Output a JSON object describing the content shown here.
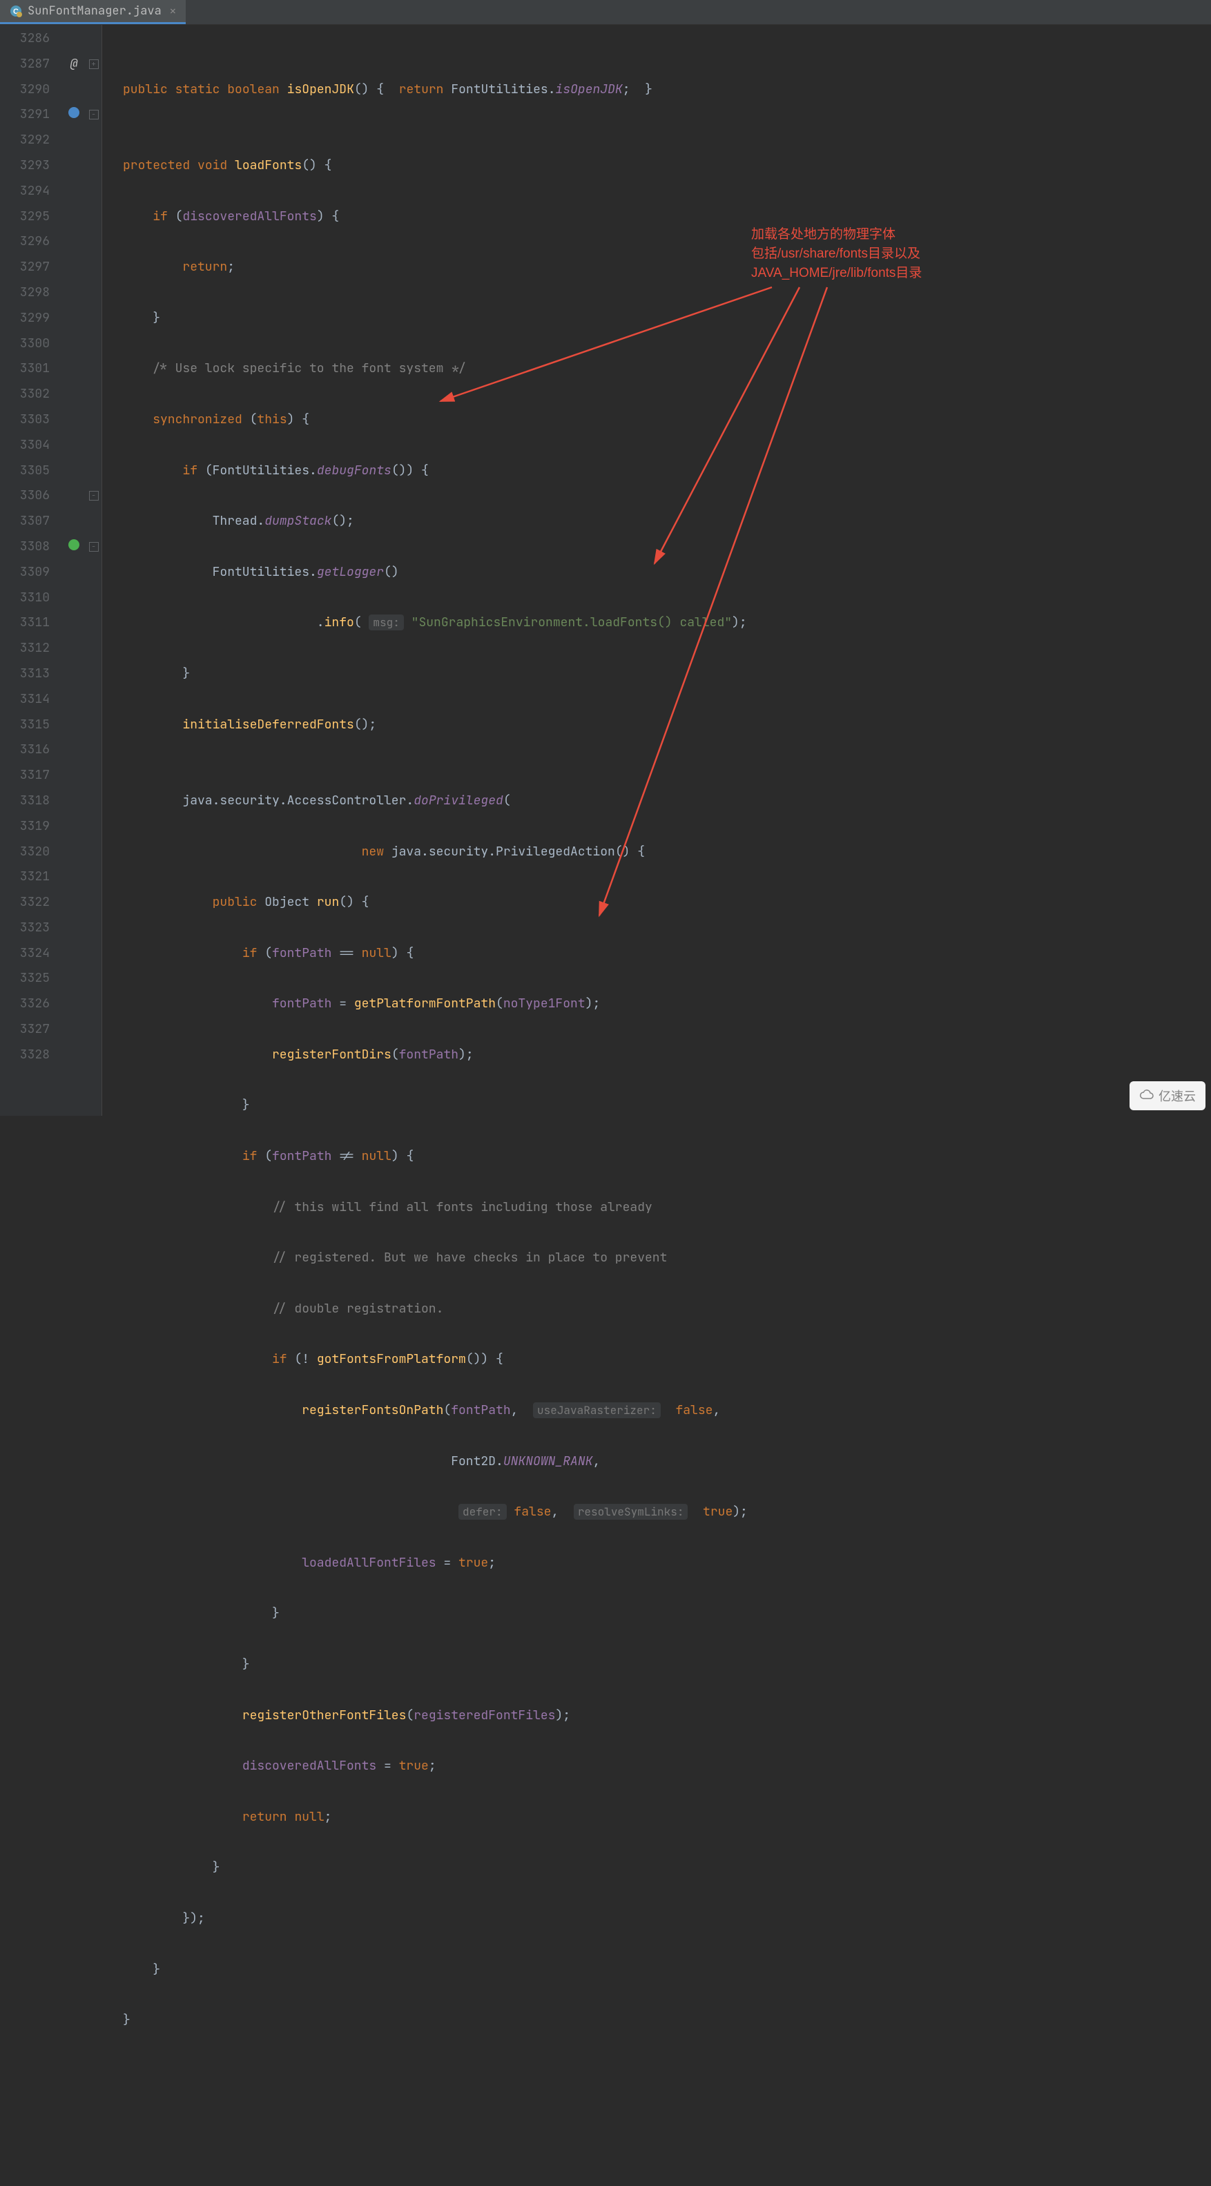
{
  "tab": {
    "filename": "SunFontManager.java"
  },
  "line_numbers": [
    "3286",
    "3287",
    "3290",
    "3291",
    "3292",
    "3293",
    "3294",
    "3295",
    "3296",
    "3297",
    "3298",
    "3299",
    "3300",
    "3301",
    "3302",
    "3303",
    "3304",
    "3305",
    "3306",
    "3307",
    "3308",
    "3309",
    "3310",
    "3311",
    "3312",
    "3313",
    "3314",
    "3315",
    "3316",
    "3317",
    "3318",
    "3319",
    "3320",
    "3321",
    "3322",
    "3323",
    "3324",
    "3325",
    "3326",
    "3327",
    "3328"
  ],
  "annotation": {
    "l1": "加载各处地方的物理字体",
    "l2": "包括/usr/share/fonts目录以及",
    "l3": "JAVA_HOME/jre/lib/fonts目录"
  },
  "watermark": "亿速云",
  "code": {
    "public": "public",
    "static": "static",
    "boolean": "boolean",
    "isOpenJDK": "isOpenJDK",
    "return": "return",
    "FontUtilities": "FontUtilities",
    "protected": "protected",
    "void": "void",
    "loadFonts": "loadFonts",
    "if": "if",
    "discoveredAllFonts": "discoveredAllFonts",
    "cmt_uselock": "/* Use lock specific to the font system */",
    "synchronized": "synchronized",
    "this": "this",
    "debugFonts": "debugFonts",
    "Thread": "Thread",
    "dumpStack": "dumpStack",
    "getLogger": "getLogger",
    "info": "info",
    "msg_hint": "msg:",
    "msg_str": "\"SunGraphicsEnvironment.loadFonts() called\"",
    "initialiseDeferredFonts": "initialiseDeferredFonts",
    "java_security_AccessController": "java.security.AccessController.",
    "doPrivileged": "doPrivileged",
    "new": "new",
    "PrivilegedAction": "java.security.PrivilegedAction()",
    "Object": "Object",
    "run": "run",
    "fontPath": "fontPath",
    "null": "null",
    "getPlatformFontPath": "getPlatformFontPath",
    "noType1Font": "noType1Font",
    "registerFontDirs": "registerFontDirs",
    "cmt_find": "// this will find all fonts including those already",
    "cmt_reg": "// registered. But we have checks in place to prevent",
    "cmt_double": "// double registration.",
    "gotFontsFromPlatform": "gotFontsFromPlatform",
    "registerFontsOnPath": "registerFontsOnPath",
    "useJavaRasterizer_hint": "useJavaRasterizer:",
    "false": "false",
    "true": "true",
    "Font2D": "Font2D",
    "UNKNOWN_RANK": "UNKNOWN_RANK",
    "defer_hint": "defer:",
    "resolveSymLinks_hint": "resolveSymLinks:",
    "loadedAllFontFiles": "loadedAllFontFiles",
    "registerOtherFontFiles": "registerOtherFontFiles",
    "registeredFontFiles": "registeredFontFiles"
  }
}
